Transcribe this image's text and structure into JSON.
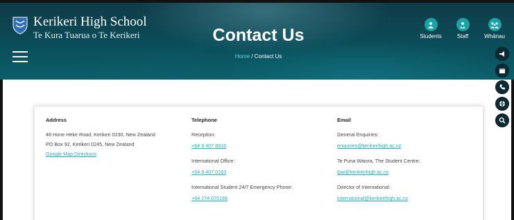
{
  "header": {
    "school_name": "Kerikeri High School",
    "school_subtitle": "Te Kura Tuarua o Te Kerikeri",
    "page_title": "Contact Us",
    "breadcrumb": {
      "home": "Home",
      "separator": "/",
      "current": "Contact Us"
    },
    "top_links": [
      {
        "label": "Students",
        "icon": "student-icon"
      },
      {
        "label": "Staff",
        "icon": "staff-icon"
      },
      {
        "label": "Whānau",
        "icon": "family-icon"
      }
    ],
    "side_tools": [
      "megaphone-icon",
      "calendar-icon",
      "phone-icon",
      "globe-icon",
      "search-icon"
    ]
  },
  "contact": {
    "address": {
      "heading": "Address",
      "line1": "48 Hone Heke Road, Kerikeri 0230, New Zealand",
      "line2": "PO Box 92, Kerikeri 0245, New Zealand",
      "map_link": "Google Map Directions"
    },
    "telephone": {
      "heading": "Telephone",
      "entries": [
        {
          "label": "Reception:",
          "value": "+64 9 407 8816"
        },
        {
          "label": "International Office:",
          "value": "+64 9 407 0163"
        },
        {
          "label": "International Student 24/7 Emergency Phone:",
          "value": "+64 274 070166"
        }
      ]
    },
    "email": {
      "heading": "Email",
      "entries": [
        {
          "label": "General Enquiries:",
          "value": "enquiries@kerikerihigh.ac.nz"
        },
        {
          "label": "Te Puna Waiora, The Student Centre:",
          "value": "tpw@kerikerihigh.ac.nz"
        },
        {
          "label": "Director of International:",
          "value": "international@kerikerihigh.ac.nz"
        }
      ]
    }
  },
  "colors": {
    "accent": "#1ab3c0",
    "header_dark": "#0f3b47",
    "icon_bg": "#1aa3a8"
  }
}
